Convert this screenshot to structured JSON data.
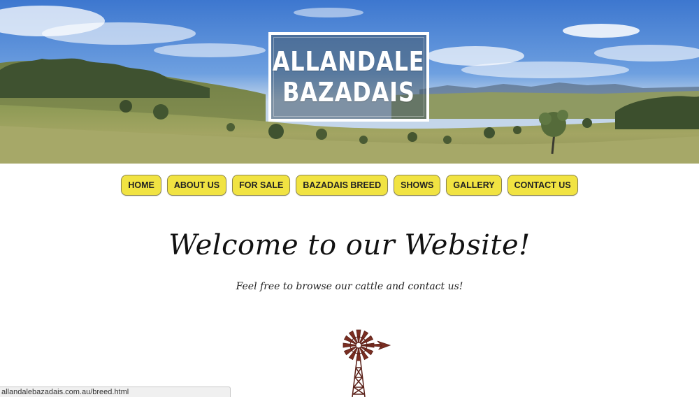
{
  "header": {
    "logo_line1": "ALLANDALE",
    "logo_line2": "BAZADAIS"
  },
  "nav": {
    "items": [
      {
        "label": "HOME"
      },
      {
        "label": "ABOUT US"
      },
      {
        "label": "FOR SALE"
      },
      {
        "label": "BAZADAIS BREED"
      },
      {
        "label": "SHOWS"
      },
      {
        "label": "GALLERY"
      },
      {
        "label": "CONTACT US"
      }
    ]
  },
  "main": {
    "heading": "Welcome to our Website!",
    "subheading": "Feel free to browse our cattle and contact us!"
  },
  "status_bar": {
    "url": "allandalebazadais.com.au/breed.html"
  },
  "colors": {
    "nav_button_bg": "#f1e342",
    "nav_button_border": "#8a8450",
    "logo_border": "#ffffff",
    "sky": "#4f86d6",
    "grass": "#9aa25c",
    "windmill": "#7a2e22"
  },
  "icons": {
    "windmill": "windmill-icon"
  }
}
